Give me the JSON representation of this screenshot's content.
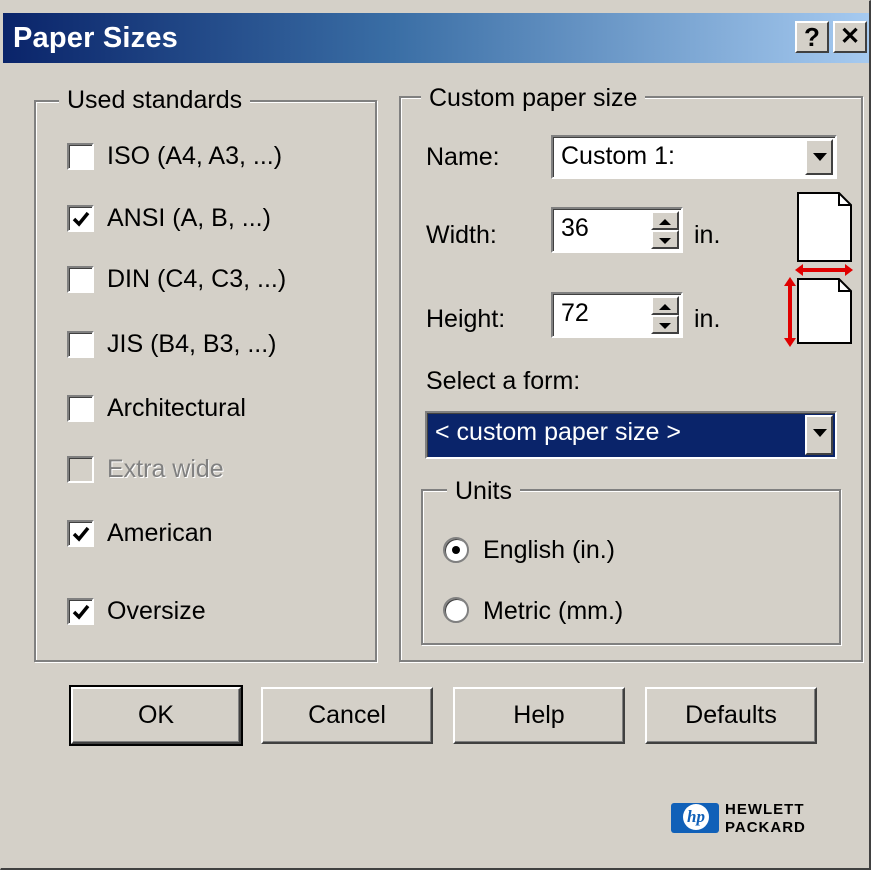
{
  "window": {
    "title": "Paper Sizes",
    "help_button": "?",
    "close_button": "✕"
  },
  "used_standards": {
    "legend": "Used standards",
    "items": [
      {
        "label": "ISO (A4, A3, ...)",
        "checked": false,
        "enabled": true
      },
      {
        "label": "ANSI (A, B, ...)",
        "checked": true,
        "enabled": true
      },
      {
        "label": "DIN (C4, C3, ...)",
        "checked": false,
        "enabled": true
      },
      {
        "label": "JIS (B4, B3, ...)",
        "checked": false,
        "enabled": true
      },
      {
        "label": "Architectural",
        "checked": false,
        "enabled": true
      },
      {
        "label": "Extra wide",
        "checked": false,
        "enabled": false
      },
      {
        "label": "American",
        "checked": true,
        "enabled": true
      },
      {
        "label": "Oversize",
        "checked": true,
        "enabled": true
      }
    ]
  },
  "custom_paper": {
    "legend": "Custom paper size",
    "name_label": "Name:",
    "name_value": "Custom 1:",
    "width_label": "Width:",
    "width_value": "36",
    "width_unit": "in.",
    "height_label": "Height:",
    "height_value": "72",
    "height_unit": "in.",
    "form_label": "Select a form:",
    "form_value": "< custom paper size >",
    "units": {
      "legend": "Units",
      "options": [
        {
          "label": "English (in.)",
          "selected": true
        },
        {
          "label": "Metric (mm.)",
          "selected": false
        }
      ]
    }
  },
  "buttons": {
    "ok": "OK",
    "cancel": "Cancel",
    "help": "Help",
    "defaults": "Defaults"
  },
  "brand": {
    "logo_text": "hp",
    "line1": "HEWLETT",
    "line2": "PACKARD"
  },
  "colors": {
    "title_gradient_start": "#0a246a",
    "title_gradient_end": "#a6caf0",
    "dialog_face": "#d4d0c8",
    "selection": "#0a246a",
    "arrow_red": "#e00000"
  }
}
